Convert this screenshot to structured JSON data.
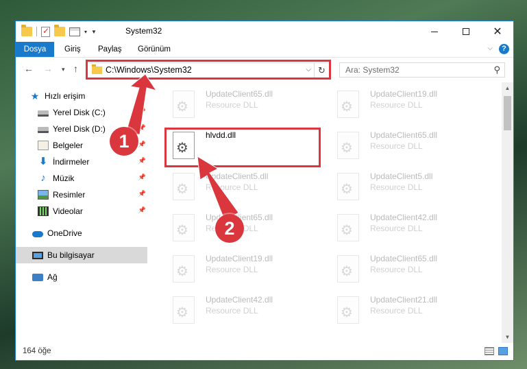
{
  "window": {
    "title": "System32",
    "controls": {
      "minimize": "minimize-icon",
      "maximize": "maximize-icon",
      "close": "close-icon"
    }
  },
  "ribbon": {
    "tabs": [
      "Dosya",
      "Giriş",
      "Paylaş",
      "Görünüm"
    ],
    "help_label": "?"
  },
  "address": {
    "path": "C:\\Windows\\System32",
    "refresh_icon": "↻"
  },
  "search": {
    "placeholder": "Ara: System32"
  },
  "sidebar": {
    "items": [
      {
        "label": "Hızlı erişim",
        "icon": "star-icon",
        "pinned": false
      },
      {
        "label": "Yerel Disk (C:)",
        "icon": "disk-icon",
        "pinned": true
      },
      {
        "label": "Yerel Disk (D:)",
        "icon": "disk-icon",
        "pinned": true
      },
      {
        "label": "Belgeler",
        "icon": "documents-icon",
        "pinned": true
      },
      {
        "label": "İndirmeler",
        "icon": "download-icon",
        "pinned": true
      },
      {
        "label": "Müzik",
        "icon": "music-icon",
        "pinned": true
      },
      {
        "label": "Resimler",
        "icon": "pictures-icon",
        "pinned": true
      },
      {
        "label": "Videolar",
        "icon": "videos-icon",
        "pinned": true
      },
      {
        "label": "OneDrive",
        "icon": "cloud-icon",
        "pinned": false
      },
      {
        "label": "Bu bilgisayar",
        "icon": "computer-icon",
        "pinned": false,
        "selected": true
      },
      {
        "label": "Ağ",
        "icon": "network-icon",
        "pinned": false
      }
    ]
  },
  "files": [
    {
      "name": "UpdateClient65.dll",
      "type": "Resource DLL"
    },
    {
      "name": "UpdateClient19.dll",
      "type": "Resource DLL"
    },
    {
      "name": "hlvdd.dll",
      "type": ""
    },
    {
      "name": "UpdateClient65.dll",
      "type": "Resource DLL"
    },
    {
      "name": "UpdateClient5.dll",
      "type": "Resource DLL"
    },
    {
      "name": "UpdateClient5.dll",
      "type": "Resource DLL"
    },
    {
      "name": "UpdateClient65.dll",
      "type": "Resource DLL"
    },
    {
      "name": "UpdateClient42.dll",
      "type": "Resource DLL"
    },
    {
      "name": "UpdateClient19.dll",
      "type": "Resource DLL"
    },
    {
      "name": "UpdateClient65.dll",
      "type": "Resource DLL"
    },
    {
      "name": "UpdateClient42.dll",
      "type": "Resource DLL"
    },
    {
      "name": "UpdateClient21.dll",
      "type": "Resource DLL"
    }
  ],
  "status": {
    "item_count": "164 öğe"
  },
  "annotations": {
    "marker_1": "1",
    "marker_2": "2",
    "color": "#d9363e"
  }
}
